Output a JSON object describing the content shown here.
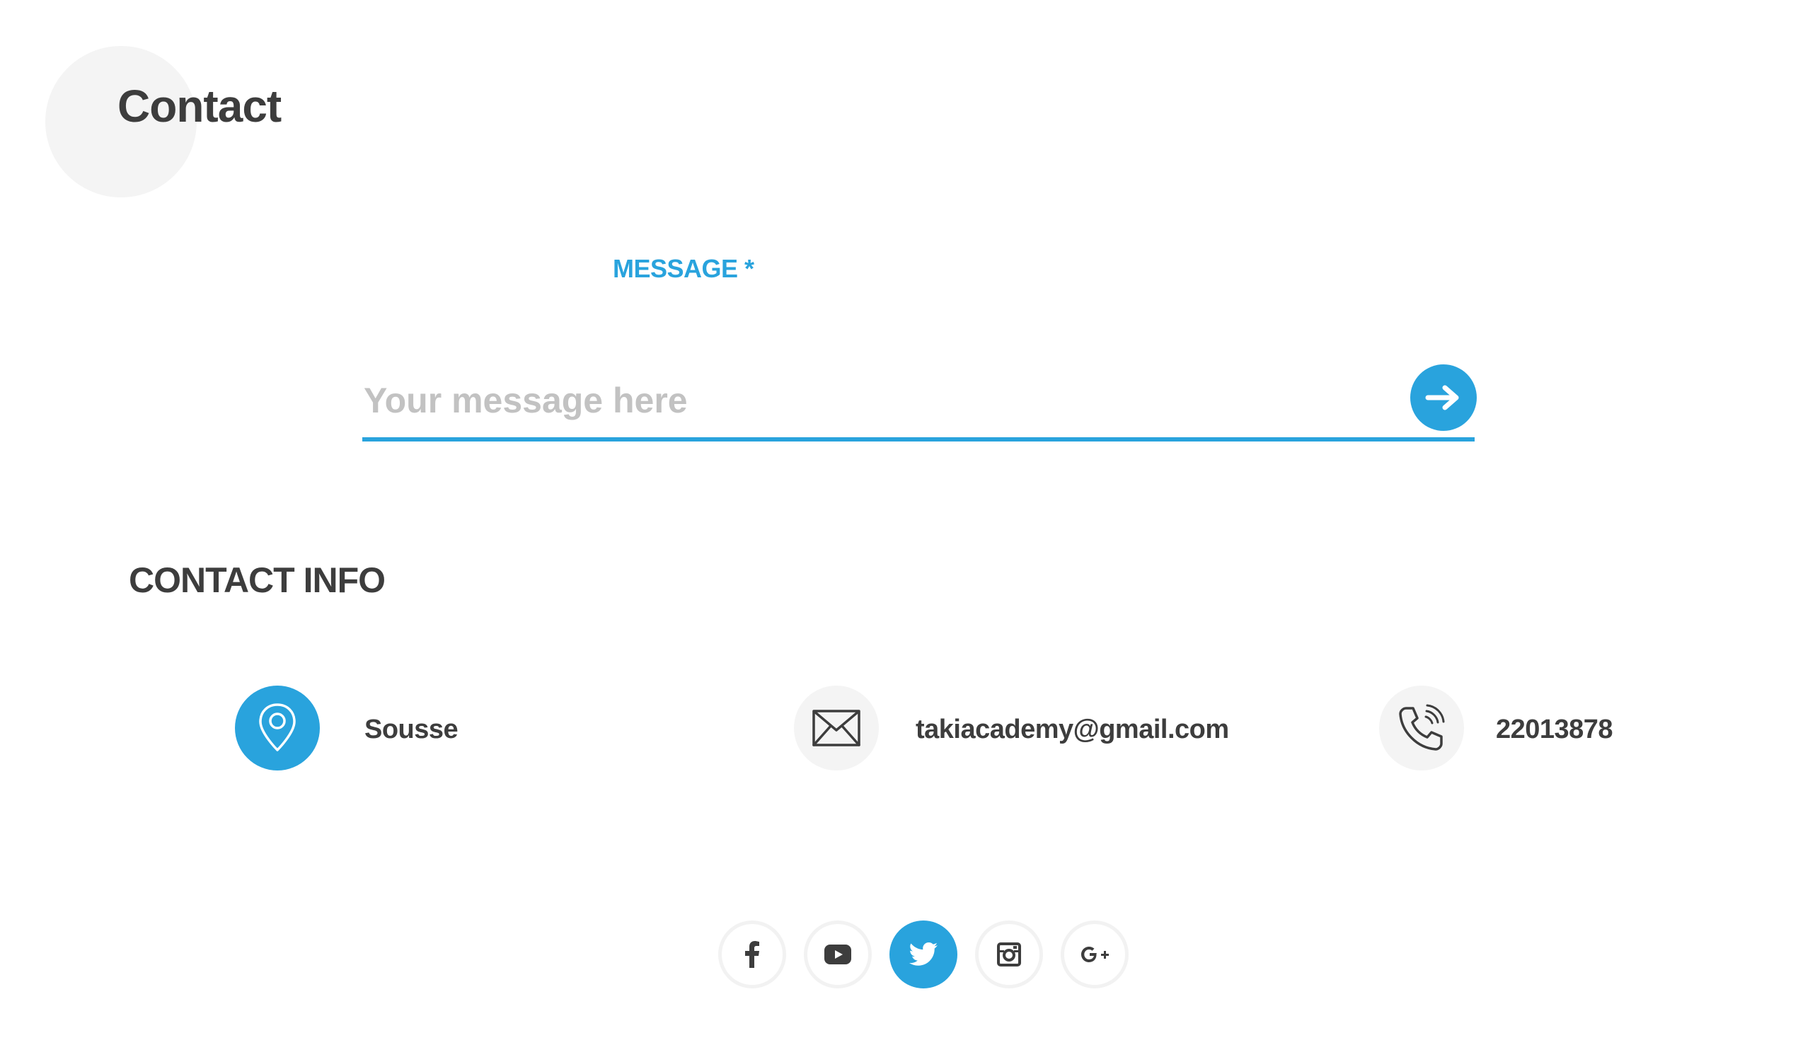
{
  "page": {
    "title": "Contact"
  },
  "form": {
    "message_label": "MESSAGE *",
    "message_placeholder": "Your message here",
    "message_value": "",
    "send_icon": "arrow-right-icon"
  },
  "contact_info": {
    "heading": "CONTACT INFO",
    "items": [
      {
        "icon": "location-pin-icon",
        "text": "Sousse"
      },
      {
        "icon": "envelope-icon",
        "text": "takiacademy@gmail.com"
      },
      {
        "icon": "phone-icon",
        "text": "22013878"
      }
    ]
  },
  "social": [
    {
      "icon": "facebook-icon",
      "active": false
    },
    {
      "icon": "youtube-icon",
      "active": false
    },
    {
      "icon": "twitter-icon",
      "active": true
    },
    {
      "icon": "instagram-icon",
      "active": false
    },
    {
      "icon": "google-plus-icon",
      "active": false
    }
  ],
  "colors": {
    "accent": "#29a3dd",
    "text": "#3d3d3d",
    "placeholder": "#c2c2c2",
    "circle_bg": "#f4f4f4"
  }
}
